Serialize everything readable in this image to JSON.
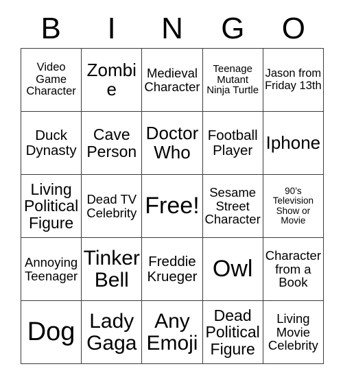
{
  "header": {
    "letters": [
      "B",
      "I",
      "N",
      "G",
      "O"
    ]
  },
  "grid": {
    "rows": [
      [
        {
          "text": "Video Game Character",
          "size": "fs-16"
        },
        {
          "text": "Zombie",
          "size": "fs-26"
        },
        {
          "text": "Medieval Character",
          "size": "fs-18"
        },
        {
          "text": "Teenage Mutant Ninja Turtle",
          "size": "fs-15"
        },
        {
          "text": "Jason from Friday 13th",
          "size": "fs-16"
        }
      ],
      [
        {
          "text": "Duck Dynasty",
          "size": "fs-20"
        },
        {
          "text": "Cave Person",
          "size": "fs-23"
        },
        {
          "text": "Doctor Who",
          "size": "fs-26"
        },
        {
          "text": "Football Player",
          "size": "fs-20"
        },
        {
          "text": "Iphone",
          "size": "fs-26"
        }
      ],
      [
        {
          "text": "Living Political Figure",
          "size": "fs-23"
        },
        {
          "text": "Dead TV Celebrity",
          "size": "fs-18"
        },
        {
          "text": "Free!",
          "size": "fs-34"
        },
        {
          "text": "Sesame Street Character",
          "size": "fs-18"
        },
        {
          "text": "90’s Television Show or Movie",
          "size": "fs-13"
        }
      ],
      [
        {
          "text": "Annoying Teenager",
          "size": "fs-18"
        },
        {
          "text": "Tinker Bell",
          "size": "fs-30"
        },
        {
          "text": "Freddie Krueger",
          "size": "fs-20"
        },
        {
          "text": "Owl",
          "size": "fs-34"
        },
        {
          "text": "Character from a Book",
          "size": "fs-18"
        }
      ],
      [
        {
          "text": "Dog",
          "size": "fs-38"
        },
        {
          "text": "Lady Gaga",
          "size": "fs-30"
        },
        {
          "text": "Any Emoji",
          "size": "fs-30"
        },
        {
          "text": "Dead Political Figure",
          "size": "fs-23"
        },
        {
          "text": "Living Movie Celebrity",
          "size": "fs-18"
        }
      ]
    ]
  },
  "colors": {
    "border": "#3a3a3a",
    "text": "#000000",
    "background": "#ffffff"
  }
}
